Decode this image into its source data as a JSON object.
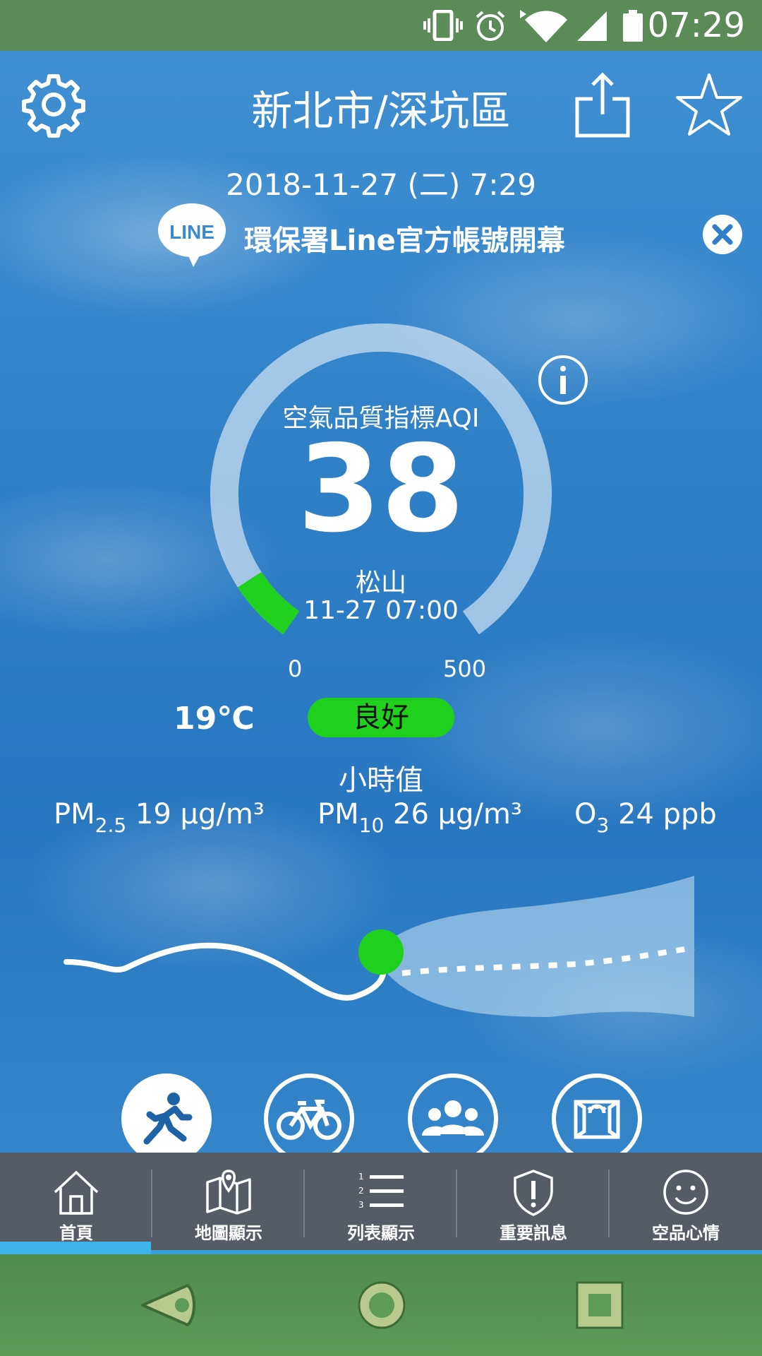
{
  "status_bar": {
    "time": "07:29"
  },
  "header": {
    "title": "新北市/深坑區",
    "datetime": "2018-11-27 (二) 7:29"
  },
  "banner": {
    "logo_text": "LINE",
    "text": "環保署Line官方帳號開幕"
  },
  "aqi": {
    "label": "空氣品質指標AQI",
    "value": "38",
    "station": "松山",
    "time": "11-27 07:00",
    "scale_min": "0",
    "scale_max": "500",
    "level_color": "#1fd11c",
    "fraction": 0.076
  },
  "conditions": {
    "temperature": "19℃",
    "status": "良好"
  },
  "hourly": {
    "title": "小時值",
    "pm25": {
      "name": "PM",
      "sub": "2.5",
      "value": "19 μg/m³"
    },
    "pm10": {
      "name": "PM",
      "sub": "10",
      "value": "26 μg/m³"
    },
    "o3": {
      "name": "O",
      "sub": "3",
      "value": "24 ppb"
    }
  },
  "activities": [
    "running-icon",
    "bicycle-icon",
    "group-icon",
    "window-icon"
  ],
  "bottom_nav": {
    "items": [
      {
        "label": "首頁",
        "icon": "home-icon"
      },
      {
        "label": "地圖顯示",
        "icon": "map-icon"
      },
      {
        "label": "列表顯示",
        "icon": "list-icon"
      },
      {
        "label": "重要訊息",
        "icon": "shield-alert-icon"
      },
      {
        "label": "空品心情",
        "icon": "smiley-icon"
      }
    ],
    "accent": "#3fb3e8"
  }
}
